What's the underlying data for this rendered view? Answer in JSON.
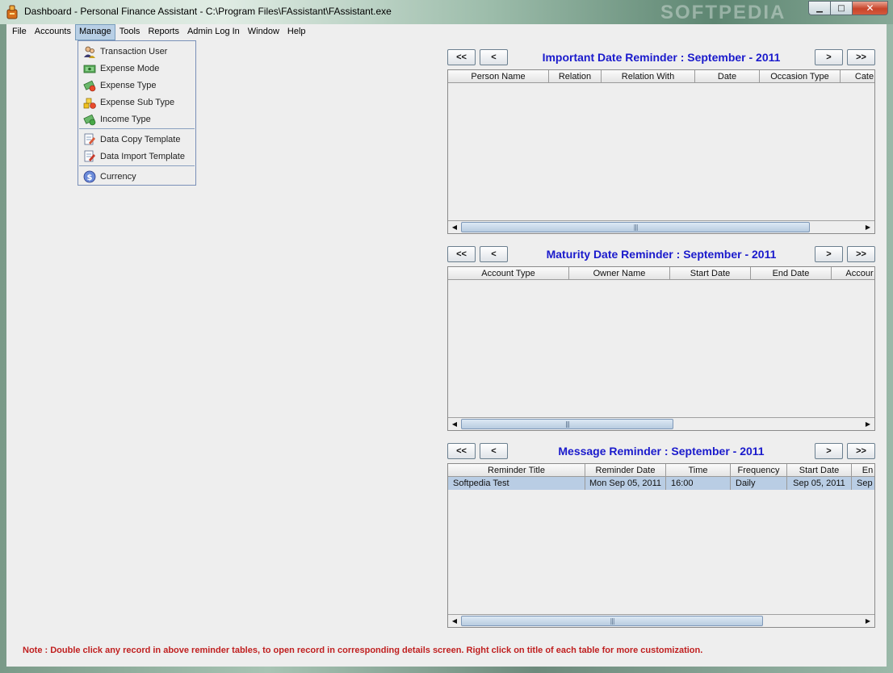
{
  "window": {
    "title": "Dashboard - Personal Finance Assistant - C:\\Program Files\\FAssistant\\FAssistant.exe",
    "watermark": "SOFTPEDIA",
    "minimize_glyph": "▁",
    "maximize_glyph": "□",
    "close_glyph": "✕"
  },
  "menubar": {
    "items": [
      {
        "label": "File"
      },
      {
        "label": "Accounts"
      },
      {
        "label": "Manage"
      },
      {
        "label": "Tools"
      },
      {
        "label": "Reports"
      },
      {
        "label": "Admin Log In"
      },
      {
        "label": "Window"
      },
      {
        "label": "Help"
      }
    ]
  },
  "manage_menu": {
    "items": [
      {
        "label": "Transaction User",
        "icon": "users-icon"
      },
      {
        "label": "Expense Mode",
        "icon": "cash-mode-icon"
      },
      {
        "label": "Expense Type",
        "icon": "expense-type-icon"
      },
      {
        "label": "Expense Sub Type",
        "icon": "expense-subtype-icon"
      },
      {
        "label": "Income Type",
        "icon": "income-type-icon"
      },
      {
        "label": "Data Copy Template",
        "icon": "copy-template-icon"
      },
      {
        "label": "Data Import Template",
        "icon": "import-template-icon"
      },
      {
        "label": "Currency",
        "icon": "currency-icon"
      }
    ]
  },
  "nav": {
    "first": "<<",
    "prev": "<",
    "next": ">",
    "last": ">>"
  },
  "important_reminder": {
    "title": "Important Date Reminder : September - 2011",
    "columns": [
      "Person Name",
      "Relation",
      "Relation With",
      "Date",
      "Occasion Type",
      "Cate"
    ],
    "rows": []
  },
  "maturity_reminder": {
    "title": "Maturity Date Reminder : September - 2011",
    "columns": [
      "Account Type",
      "Owner Name",
      "Start Date",
      "End Date",
      "Accour"
    ],
    "rows": []
  },
  "message_reminder": {
    "title": "Message Reminder : September - 2011",
    "columns": [
      "Reminder Title",
      "Reminder Date",
      "Time",
      "Frequency",
      "Start Date",
      "En"
    ],
    "rows": [
      [
        "Softpedia Test",
        "Mon Sep 05, 2011",
        "16:00",
        "Daily",
        "Sep 05, 2011",
        "Sep"
      ]
    ]
  },
  "scrollbar": {
    "left_glyph": "◀",
    "right_glyph": "▶",
    "grip": "|||"
  },
  "note": "Note : Double click any record in above reminder tables, to open record in corresponding details screen. Right click on title of each table for more customization."
}
